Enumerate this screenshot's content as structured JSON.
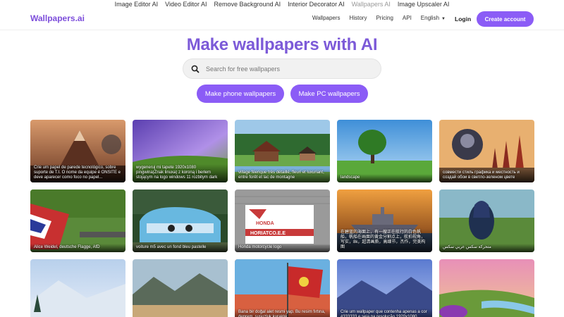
{
  "top_strip": [
    "Image Editor AI",
    "Video Editor AI",
    "Remove Background AI",
    "Interior Decorator AI",
    "Wallpapers AI",
    "Image Upscaler AI"
  ],
  "header": {
    "logo": "Wallpapers.ai",
    "nav": [
      "Wallpapers",
      "History",
      "Pricing",
      "API",
      "English"
    ],
    "login": "Login",
    "create_account": "Create account"
  },
  "hero": {
    "title": "Make wallpapers with AI",
    "search_placeholder": "Search for free wallpapers",
    "phone_button": "Make phone wallpapers",
    "pc_button": "Make PC wallpapers"
  },
  "colors": {
    "accent": "#8b5cf6",
    "title": "#7c5ad8"
  },
  "gallery": [
    {
      "caption": "Crie um papel de parede tecnológico, sobre suporte de T.I. O nome da equipe é ONSITE e deve aparecer como foco no papel..."
    },
    {
      "caption": "wygeneruj mi tapete 1920x1080 pingwina(Znak linuxa) z koroną i berłem stojącym na logo windows 11 rozbitym dark"
    },
    {
      "caption": "village féerique très détaillé, fleuri et luxuriant, entre forêt et lac de montagne"
    },
    {
      "caption": "landscape"
    },
    {
      "caption": "совмести стиль графика и местность и создай обои в светло-зеленом цвете"
    },
    {
      "caption": "Alice Weidel, deutsche Flagge, AfD"
    },
    {
      "caption": "voiture m5 avec un fond bleu pastelle"
    },
    {
      "caption": "Honda motorcycle logo"
    },
    {
      "caption": "在碧蓝的海面上，有一艘正在航行的白色帆船，帆船在画面的黄金分割点上，航拍视角，写实，8k，超清画质，高细节，杰作，完美构图"
    },
    {
      "caption": "متحركة سكس عربي سكس"
    },
    {
      "caption": ""
    },
    {
      "caption": ""
    },
    {
      "caption": "Bana bir doğal alet resmi yap. Bu resim fırtına, deprem, susuzluk kuraklık, ..."
    },
    {
      "caption": "Crie um wallpaper que contenha apenas a cor #333333 e seja na resolução 1920x1080"
    },
    {
      "caption": ""
    }
  ]
}
